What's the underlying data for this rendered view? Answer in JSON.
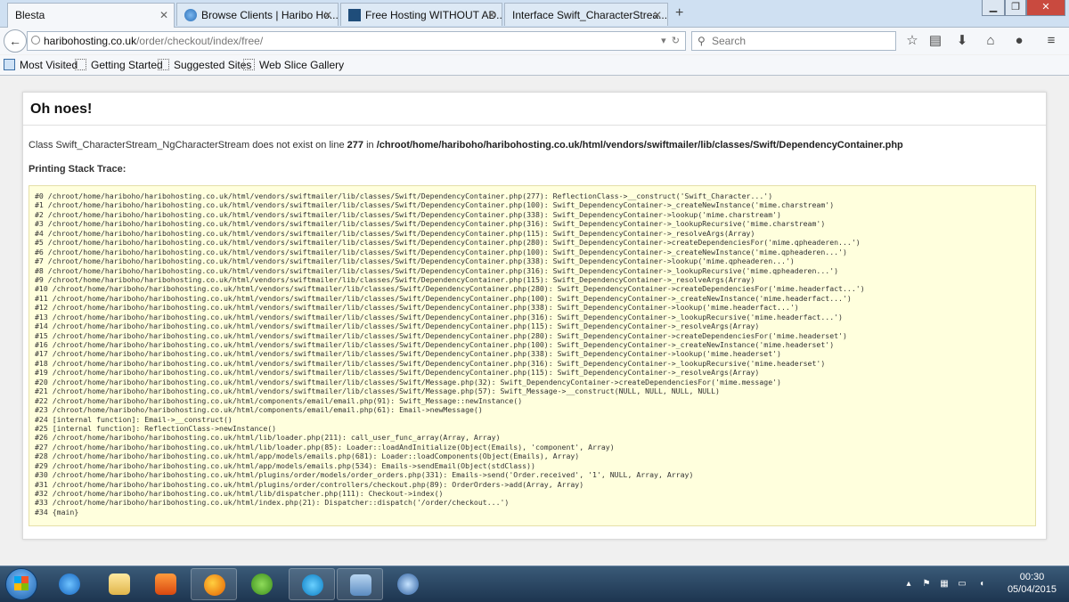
{
  "browser": {
    "tabs": [
      {
        "title": "Blesta",
        "active": true
      },
      {
        "title": "Browse Clients | Haribo Ho...",
        "active": false
      },
      {
        "title": "Free Hosting WITHOUT AD...",
        "active": false
      },
      {
        "title": "Interface Swift_CharacterStrea...",
        "active": false
      }
    ],
    "new_tab": "+",
    "url_host": "haribohosting.co.uk",
    "url_path": "/order/checkout/index/free/",
    "search_placeholder": "Search",
    "bookmarks": [
      "Most Visited",
      "Getting Started",
      "Suggested Sites",
      "Web Slice Gallery"
    ]
  },
  "page": {
    "heading": "Oh noes!",
    "error": {
      "prefix": "Class Swift_CharacterStream_NgCharacterStream does not exist on line",
      "line": "277",
      "in": "in",
      "file": "/chroot/home/hariboho/haribohosting.co.uk/html/vendors/swiftmailer/lib/classes/Swift/DependencyContainer.php"
    },
    "trace_title": "Printing Stack Trace:",
    "trace": [
      "#0 /chroot/home/hariboho/haribohosting.co.uk/html/vendors/swiftmailer/lib/classes/Swift/DependencyContainer.php(277): ReflectionClass->__construct('Swift_Character...')",
      "#1 /chroot/home/hariboho/haribohosting.co.uk/html/vendors/swiftmailer/lib/classes/Swift/DependencyContainer.php(100): Swift_DependencyContainer->_createNewInstance('mime.charstream')",
      "#2 /chroot/home/hariboho/haribohosting.co.uk/html/vendors/swiftmailer/lib/classes/Swift/DependencyContainer.php(338): Swift_DependencyContainer->lookup('mime.charstream')",
      "#3 /chroot/home/hariboho/haribohosting.co.uk/html/vendors/swiftmailer/lib/classes/Swift/DependencyContainer.php(316): Swift_DependencyContainer->_lookupRecursive('mime.charstream')",
      "#4 /chroot/home/hariboho/haribohosting.co.uk/html/vendors/swiftmailer/lib/classes/Swift/DependencyContainer.php(115): Swift_DependencyContainer->_resolveArgs(Array)",
      "#5 /chroot/home/hariboho/haribohosting.co.uk/html/vendors/swiftmailer/lib/classes/Swift/DependencyContainer.php(280): Swift_DependencyContainer->createDependenciesFor('mime.qpheaderen...')",
      "#6 /chroot/home/hariboho/haribohosting.co.uk/html/vendors/swiftmailer/lib/classes/Swift/DependencyContainer.php(100): Swift_DependencyContainer->_createNewInstance('mime.qpheaderen...')",
      "#7 /chroot/home/hariboho/haribohosting.co.uk/html/vendors/swiftmailer/lib/classes/Swift/DependencyContainer.php(338): Swift_DependencyContainer->lookup('mime.qpheaderen...')",
      "#8 /chroot/home/hariboho/haribohosting.co.uk/html/vendors/swiftmailer/lib/classes/Swift/DependencyContainer.php(316): Swift_DependencyContainer->_lookupRecursive('mime.qpheaderen...')",
      "#9 /chroot/home/hariboho/haribohosting.co.uk/html/vendors/swiftmailer/lib/classes/Swift/DependencyContainer.php(115): Swift_DependencyContainer->_resolveArgs(Array)",
      "#10 /chroot/home/hariboho/haribohosting.co.uk/html/vendors/swiftmailer/lib/classes/Swift/DependencyContainer.php(280): Swift_DependencyContainer->createDependenciesFor('mime.headerfact...')",
      "#11 /chroot/home/hariboho/haribohosting.co.uk/html/vendors/swiftmailer/lib/classes/Swift/DependencyContainer.php(100): Swift_DependencyContainer->_createNewInstance('mime.headerfact...')",
      "#12 /chroot/home/hariboho/haribohosting.co.uk/html/vendors/swiftmailer/lib/classes/Swift/DependencyContainer.php(338): Swift_DependencyContainer->lookup('mime.headerfact...')",
      "#13 /chroot/home/hariboho/haribohosting.co.uk/html/vendors/swiftmailer/lib/classes/Swift/DependencyContainer.php(316): Swift_DependencyContainer->_lookupRecursive('mime.headerfact...')",
      "#14 /chroot/home/hariboho/haribohosting.co.uk/html/vendors/swiftmailer/lib/classes/Swift/DependencyContainer.php(115): Swift_DependencyContainer->_resolveArgs(Array)",
      "#15 /chroot/home/hariboho/haribohosting.co.uk/html/vendors/swiftmailer/lib/classes/Swift/DependencyContainer.php(280): Swift_DependencyContainer->createDependenciesFor('mime.headerset')",
      "#16 /chroot/home/hariboho/haribohosting.co.uk/html/vendors/swiftmailer/lib/classes/Swift/DependencyContainer.php(100): Swift_DependencyContainer->_createNewInstance('mime.headerset')",
      "#17 /chroot/home/hariboho/haribohosting.co.uk/html/vendors/swiftmailer/lib/classes/Swift/DependencyContainer.php(338): Swift_DependencyContainer->lookup('mime.headerset')",
      "#18 /chroot/home/hariboho/haribohosting.co.uk/html/vendors/swiftmailer/lib/classes/Swift/DependencyContainer.php(316): Swift_DependencyContainer->_lookupRecursive('mime.headerset')",
      "#19 /chroot/home/hariboho/haribohosting.co.uk/html/vendors/swiftmailer/lib/classes/Swift/DependencyContainer.php(115): Swift_DependencyContainer->_resolveArgs(Array)",
      "#20 /chroot/home/hariboho/haribohosting.co.uk/html/vendors/swiftmailer/lib/classes/Swift/Message.php(32): Swift_DependencyContainer->createDependenciesFor('mime.message')",
      "#21 /chroot/home/hariboho/haribohosting.co.uk/html/vendors/swiftmailer/lib/classes/Swift/Message.php(57): Swift_Message->__construct(NULL, NULL, NULL, NULL)",
      "#22 /chroot/home/hariboho/haribohosting.co.uk/html/components/email/email.php(91): Swift_Message::newInstance()",
      "#23 /chroot/home/hariboho/haribohosting.co.uk/html/components/email/email.php(61): Email->newMessage()",
      "#24 [internal function]: Email->__construct()",
      "#25 [internal function]: ReflectionClass->newInstance()",
      "#26 /chroot/home/hariboho/haribohosting.co.uk/html/lib/loader.php(211): call_user_func_array(Array, Array)",
      "#27 /chroot/home/hariboho/haribohosting.co.uk/html/lib/loader.php(85): Loader::loadAndInitialize(Object(Emails), 'component', Array)",
      "#28 /chroot/home/hariboho/haribohosting.co.uk/html/app/models/emails.php(681): Loader::loadComponents(Object(Emails), Array)",
      "#29 /chroot/home/hariboho/haribohosting.co.uk/html/app/models/emails.php(534): Emails->sendEmail(Object(stdClass))",
      "#30 /chroot/home/hariboho/haribohosting.co.uk/html/plugins/order/models/order_orders.php(331): Emails->send('Order.received', '1', NULL, Array, Array)",
      "#31 /chroot/home/hariboho/haribohosting.co.uk/html/plugins/order/controllers/checkout.php(89): OrderOrders->add(Array, Array)",
      "#32 /chroot/home/hariboho/haribohosting.co.uk/html/lib/dispatcher.php(111): Checkout->index()",
      "#33 /chroot/home/hariboho/haribohosting.co.uk/html/index.php(21): Dispatcher::dispatch('/order/checkout...')",
      "#34 {main}"
    ]
  },
  "taskbar": {
    "apps": [
      "internet-explorer",
      "file-explorer",
      "media-player",
      "firefox",
      "utorrent",
      "skype",
      "control-panel",
      "thunderbird"
    ],
    "time": "00:30",
    "date": "05/04/2015"
  },
  "colors": {
    "trace_background": "#ffffdd",
    "trace_border": "#e5e0a8"
  }
}
